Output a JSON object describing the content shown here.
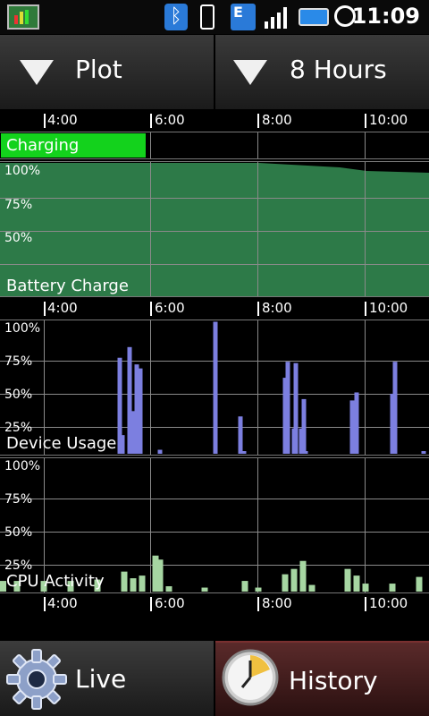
{
  "status_bar": {
    "time": "11:09",
    "icons": [
      "battery-app-icon",
      "bluetooth-icon",
      "vibrate-icon",
      "edge-data-icon",
      "signal-icon",
      "battery-icon",
      "alarm-clock-icon"
    ]
  },
  "toolbar": {
    "plot_label": "Plot",
    "range_label": "8 Hours"
  },
  "axis_labels": [
    "4:00",
    "6:00",
    "8:00",
    "10:00"
  ],
  "charging_panel": {
    "title": "Charging",
    "color": "#13d21c",
    "charging_intervals": [
      [
        "start",
        "5:20"
      ]
    ]
  },
  "battery_panel": {
    "title": "Battery Charge",
    "y_ticks": [
      "100%",
      "75%",
      "50%"
    ],
    "color": "#2d7a48"
  },
  "usage_panel": {
    "title": "Device Usage",
    "y_ticks": [
      "100%",
      "75%",
      "50%",
      "25%"
    ],
    "color": "#7c7fe0"
  },
  "cpu_panel": {
    "title": "CPU Activity",
    "y_ticks": [
      "100%",
      "75%",
      "50%",
      "25%"
    ],
    "color": "#a6d6a2"
  },
  "chart_data": [
    {
      "type": "area",
      "title": "Battery Charge",
      "x": [
        "3:10",
        "4:00",
        "5:00",
        "6:00",
        "7:00",
        "7:30",
        "8:00",
        "9:00",
        "10:00",
        "11:09"
      ],
      "values": [
        100,
        100,
        100,
        100,
        99,
        98,
        97,
        96,
        94,
        93
      ],
      "ylim": [
        0,
        100
      ],
      "ylabel": ""
    },
    {
      "type": "bar",
      "title": "Device Usage",
      "x": [
        "5:25",
        "5:28",
        "5:36",
        "5:40",
        "5:44",
        "5:48",
        "6:10",
        "7:12",
        "7:40",
        "7:42",
        "7:44",
        "8:30",
        "8:33",
        "8:40",
        "8:42",
        "8:48",
        "8:51",
        "8:53",
        "9:45",
        "9:50",
        "10:30",
        "10:33",
        "11:05"
      ],
      "values": [
        72,
        14,
        80,
        32,
        67,
        64,
        3,
        99,
        28,
        2,
        2,
        57,
        69,
        19,
        68,
        19,
        41,
        2,
        40,
        46,
        45,
        69,
        2
      ],
      "ylim": [
        0,
        100
      ]
    },
    {
      "type": "bar",
      "title": "CPU Activity",
      "x": [
        "3:10",
        "3:30",
        "4:00",
        "4:30",
        "5:00",
        "5:30",
        "5:40",
        "5:50",
        "6:05",
        "6:10",
        "6:20",
        "7:00",
        "7:45",
        "8:00",
        "8:30",
        "8:40",
        "8:50",
        "9:00",
        "9:40",
        "9:50",
        "10:00",
        "10:30",
        "11:00"
      ],
      "values": [
        8,
        8,
        8,
        8,
        9,
        15,
        10,
        12,
        27,
        24,
        4,
        3,
        8,
        3,
        13,
        17,
        23,
        5,
        17,
        12,
        6,
        6,
        11
      ],
      "ylim": [
        0,
        100
      ]
    }
  ],
  "bottom_nav": {
    "live_label": "Live",
    "history_label": "History"
  }
}
